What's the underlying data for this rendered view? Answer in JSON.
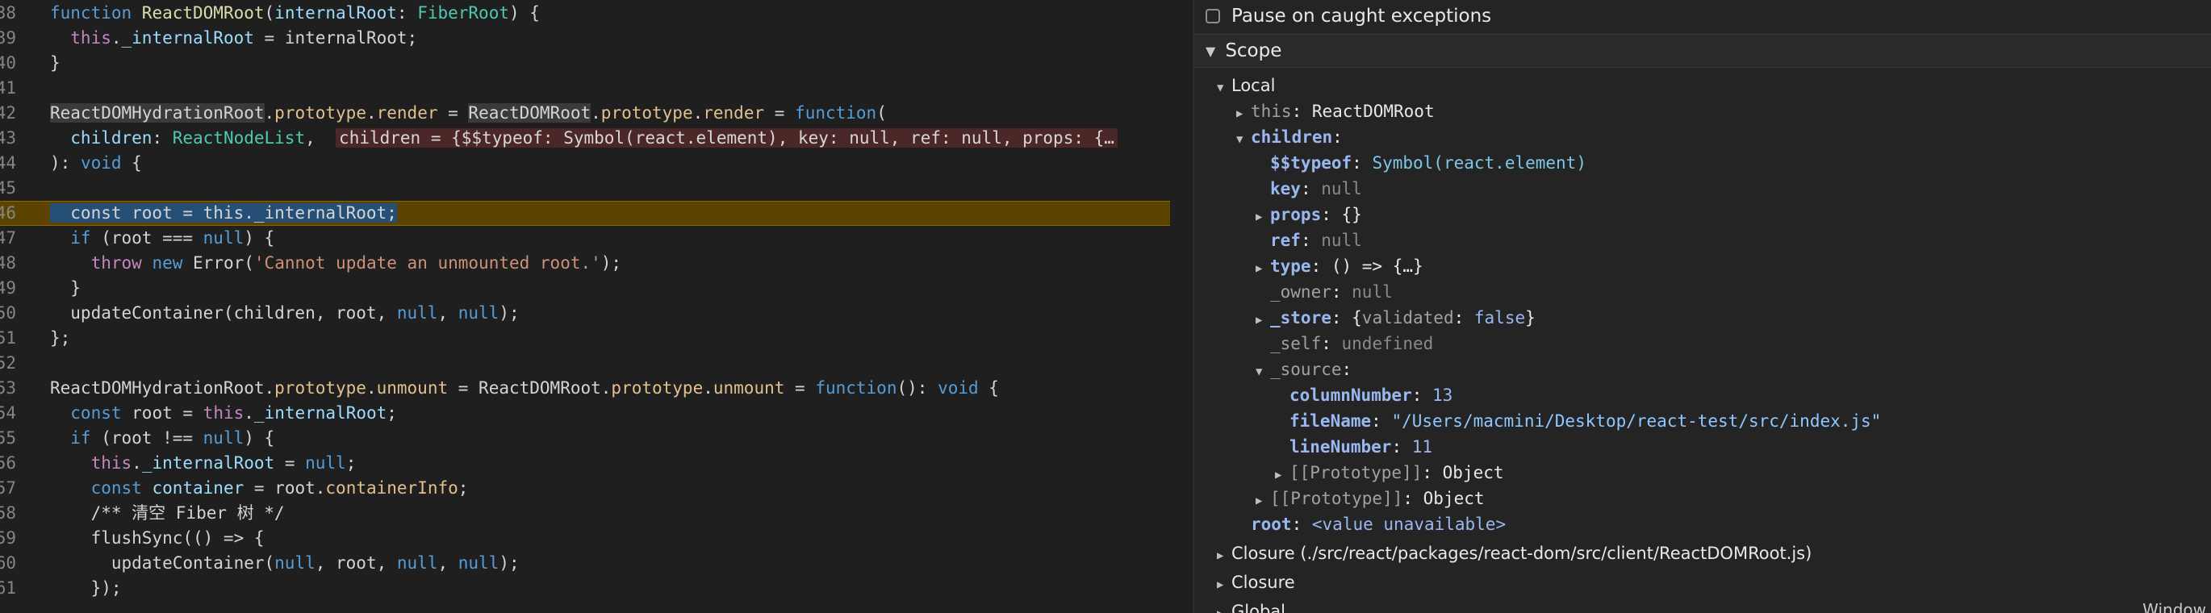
{
  "editor": {
    "lines": [
      {
        "num": "38",
        "parts": [
          [
            "kw",
            "function "
          ],
          [
            "fn",
            "ReactDOMRoot"
          ],
          [
            "",
            "("
          ],
          [
            "prop",
            "internalRoot"
          ],
          [
            "",
            ": "
          ],
          [
            "ty",
            "FiberRoot"
          ],
          [
            "",
            ") {"
          ]
        ]
      },
      {
        "num": "39",
        "parts": [
          [
            "kwc",
            "  this"
          ],
          [
            "",
            "."
          ],
          [
            "prop",
            "_internalRoot"
          ],
          [
            "",
            " = internalRoot;"
          ]
        ]
      },
      {
        "num": "40",
        "parts": [
          [
            "",
            "}"
          ]
        ]
      },
      {
        "num": "41",
        "parts": []
      },
      {
        "num": "42",
        "parts": [
          [
            "hl",
            "ReactDOMHydrationRoot"
          ],
          [
            "",
            "."
          ],
          [
            "or",
            "prototype"
          ],
          [
            "",
            "."
          ],
          [
            "or",
            "render"
          ],
          [
            "",
            " = "
          ],
          [
            "hl",
            "ReactDOMRoot"
          ],
          [
            "",
            "."
          ],
          [
            "or",
            "prototype"
          ],
          [
            "",
            "."
          ],
          [
            "or",
            "render"
          ],
          [
            "",
            " = "
          ],
          [
            "kw",
            "function"
          ],
          [
            "",
            "("
          ]
        ]
      },
      {
        "num": "43",
        "parts": [
          [
            "prop",
            "  children"
          ],
          [
            "",
            ": "
          ],
          [
            "ty",
            "ReactNodeList"
          ],
          [
            "",
            ",  "
          ],
          [
            "hint",
            "children = {$$typeof: Symbol(react.element), key: null, ref: null, props: {…"
          ]
        ]
      },
      {
        "num": "44",
        "parts": [
          [
            "",
            "): "
          ],
          [
            "kw",
            "void"
          ],
          [
            "",
            " {"
          ]
        ]
      },
      {
        "num": "45",
        "parts": []
      },
      {
        "num": "46",
        "parts": [
          [
            "sel",
            "  const root = this._internalRoot;"
          ]
        ],
        "current": true
      },
      {
        "num": "47",
        "parts": [
          [
            "kw",
            "  if"
          ],
          [
            "",
            " (root === "
          ],
          [
            "lit",
            "null"
          ],
          [
            "",
            ") {"
          ]
        ]
      },
      {
        "num": "48",
        "parts": [
          [
            "kwc",
            "    throw"
          ],
          [
            "",
            " "
          ],
          [
            "kw",
            "new"
          ],
          [
            "",
            " Error("
          ],
          [
            "str",
            "'Cannot update an unmounted root.'"
          ],
          [
            "",
            ");"
          ]
        ]
      },
      {
        "num": "49",
        "parts": [
          [
            "",
            "  }"
          ]
        ]
      },
      {
        "num": "50",
        "parts": [
          [
            "",
            "  updateContainer(children, root, "
          ],
          [
            "lit",
            "null"
          ],
          [
            "",
            ", "
          ],
          [
            "lit",
            "null"
          ],
          [
            "",
            ");"
          ]
        ]
      },
      {
        "num": "51",
        "parts": [
          [
            "",
            "};"
          ]
        ]
      },
      {
        "num": "52",
        "parts": []
      },
      {
        "num": "53",
        "parts": [
          [
            "",
            "ReactDOMHydrationRoot."
          ],
          [
            "or",
            "prototype"
          ],
          [
            "",
            "."
          ],
          [
            "or",
            "unmount"
          ],
          [
            "",
            " = ReactDOMRoot."
          ],
          [
            "or",
            "prototype"
          ],
          [
            "",
            "."
          ],
          [
            "or",
            "unmount"
          ],
          [
            "",
            " = "
          ],
          [
            "kw",
            "function"
          ],
          [
            "",
            "(): "
          ],
          [
            "kw",
            "void"
          ],
          [
            "",
            " {"
          ]
        ]
      },
      {
        "num": "54",
        "parts": [
          [
            "kw",
            "  const"
          ],
          [
            "",
            " root = "
          ],
          [
            "kwc",
            "this"
          ],
          [
            "",
            "."
          ],
          [
            "prop",
            "_internalRoot"
          ],
          [
            "",
            ";"
          ]
        ]
      },
      {
        "num": "55",
        "parts": [
          [
            "kw",
            "  if"
          ],
          [
            "",
            " (root !== "
          ],
          [
            "lit",
            "null"
          ],
          [
            "",
            ") {"
          ]
        ]
      },
      {
        "num": "56",
        "parts": [
          [
            "kwc",
            "    this"
          ],
          [
            "",
            "."
          ],
          [
            "prop",
            "_internalRoot"
          ],
          [
            "",
            " = "
          ],
          [
            "lit",
            "null"
          ],
          [
            "",
            ";"
          ]
        ]
      },
      {
        "num": "57",
        "parts": [
          [
            "kw",
            "    const"
          ],
          [
            "",
            " "
          ],
          [
            "prop",
            "container"
          ],
          [
            "",
            " = root."
          ],
          [
            "or",
            "containerInfo"
          ],
          [
            "",
            ";"
          ]
        ]
      },
      {
        "num": "58",
        "parts": [
          [
            "",
            "    /** 清空 Fiber 树 */"
          ]
        ]
      },
      {
        "num": "59",
        "parts": [
          [
            "",
            "    flushSync(() => {"
          ]
        ]
      },
      {
        "num": "60",
        "parts": [
          [
            "",
            "      updateContainer("
          ],
          [
            "lit",
            "null"
          ],
          [
            "",
            ", root, "
          ],
          [
            "lit",
            "null"
          ],
          [
            "",
            ", "
          ],
          [
            "lit",
            "null"
          ],
          [
            "",
            ");"
          ]
        ]
      },
      {
        "num": "61",
        "parts": [
          [
            "",
            "    });"
          ]
        ]
      }
    ]
  },
  "debugger": {
    "pause_label": "Pause on caught exceptions",
    "scope_title": "Scope",
    "rows": [
      {
        "indent": 0,
        "tri": "▼",
        "html": [
          [
            "plain",
            "Local"
          ]
        ]
      },
      {
        "indent": 1,
        "tri": "▶",
        "html": [
          [
            "keydim",
            "this"
          ],
          [
            "plain",
            ": ReactDOMRoot"
          ]
        ]
      },
      {
        "indent": 1,
        "tri": "▼",
        "html": [
          [
            "key",
            "children"
          ],
          [
            "plain",
            ":"
          ]
        ]
      },
      {
        "indent": 2,
        "tri": "",
        "html": [
          [
            "key",
            "$$typeof"
          ],
          [
            "plain",
            ": "
          ],
          [
            "sym",
            "Symbol(react.element)"
          ]
        ]
      },
      {
        "indent": 2,
        "tri": "",
        "html": [
          [
            "key",
            "key"
          ],
          [
            "plain",
            ": "
          ],
          [
            "null",
            "null"
          ]
        ]
      },
      {
        "indent": 2,
        "tri": "▶",
        "html": [
          [
            "key",
            "props"
          ],
          [
            "plain",
            ": {}"
          ]
        ]
      },
      {
        "indent": 2,
        "tri": "",
        "html": [
          [
            "key",
            "ref"
          ],
          [
            "plain",
            ": "
          ],
          [
            "null",
            "null"
          ]
        ]
      },
      {
        "indent": 2,
        "tri": "▶",
        "html": [
          [
            "key",
            "type"
          ],
          [
            "plain",
            ": () => {…}"
          ]
        ]
      },
      {
        "indent": 2,
        "tri": "",
        "html": [
          [
            "keydim",
            "_owner"
          ],
          [
            "plain",
            ": "
          ],
          [
            "null",
            "null"
          ]
        ]
      },
      {
        "indent": 2,
        "tri": "▶",
        "html": [
          [
            "key",
            "_store"
          ],
          [
            "plain",
            ": {"
          ],
          [
            "keydim",
            "validated"
          ],
          [
            "plain",
            ": "
          ],
          [
            "bool",
            "false"
          ],
          [
            "plain",
            "}"
          ]
        ]
      },
      {
        "indent": 2,
        "tri": "",
        "html": [
          [
            "keydim",
            "_self"
          ],
          [
            "plain",
            ": "
          ],
          [
            "null",
            "undefined"
          ]
        ]
      },
      {
        "indent": 2,
        "tri": "▼",
        "html": [
          [
            "keydim",
            "_source"
          ],
          [
            "plain",
            ":"
          ]
        ]
      },
      {
        "indent": 3,
        "tri": "",
        "html": [
          [
            "key",
            "columnNumber"
          ],
          [
            "plain",
            ": "
          ],
          [
            "num",
            "13"
          ]
        ]
      },
      {
        "indent": 3,
        "tri": "",
        "html": [
          [
            "key",
            "fileName"
          ],
          [
            "plain",
            ": "
          ],
          [
            "str",
            "\"/Users/macmini/Desktop/react-test/src/index.js\""
          ]
        ]
      },
      {
        "indent": 3,
        "tri": "",
        "html": [
          [
            "key",
            "lineNumber"
          ],
          [
            "plain",
            ": "
          ],
          [
            "num",
            "11"
          ]
        ]
      },
      {
        "indent": 3,
        "tri": "▶",
        "html": [
          [
            "keydim",
            "[[Prototype]]"
          ],
          [
            "plain",
            ": Object"
          ]
        ]
      },
      {
        "indent": 2,
        "tri": "▶",
        "html": [
          [
            "keydim",
            "[[Prototype]]"
          ],
          [
            "plain",
            ": Object"
          ]
        ]
      },
      {
        "indent": 1,
        "tri": "",
        "html": [
          [
            "key",
            "root"
          ],
          [
            "plain",
            ": "
          ],
          [
            "unav",
            "<value unavailable>"
          ]
        ]
      },
      {
        "indent": 0,
        "tri": "▶",
        "html": [
          [
            "plain",
            "Closure (./src/react/packages/react-dom/src/client/ReactDOMRoot.js)"
          ]
        ]
      },
      {
        "indent": 0,
        "tri": "▶",
        "html": [
          [
            "plain",
            "Closure"
          ]
        ]
      },
      {
        "indent": 0,
        "tri": "▶",
        "html": [
          [
            "plain",
            "Global"
          ]
        ]
      }
    ],
    "window_label": "Window"
  },
  "colors": {
    "editor_bg": "#1f1f1f",
    "panel_bg": "#242424",
    "current_line": "#5c4300",
    "selection": "#264f78"
  }
}
